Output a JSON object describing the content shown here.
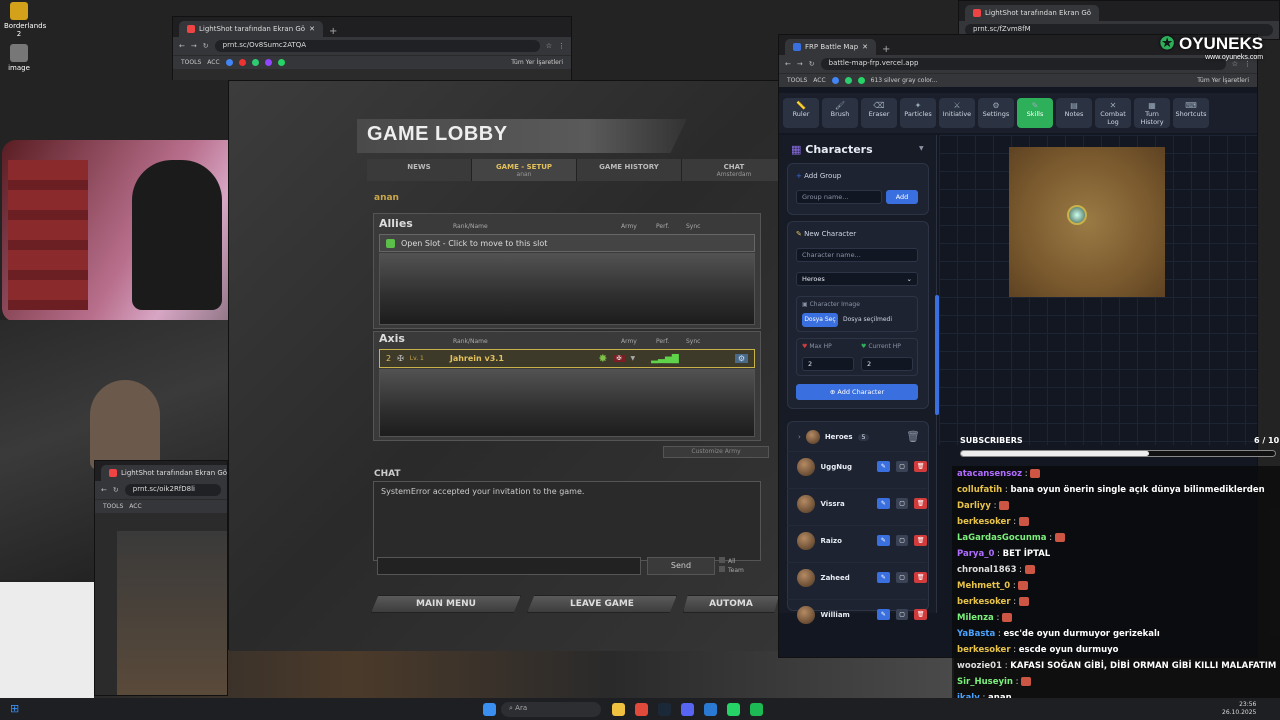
{
  "desktop": {
    "icons": [
      {
        "label": "Borderlands 2"
      },
      {
        "label": "image"
      }
    ]
  },
  "browser_left": {
    "tab_title": "LightShot tarafından Ekran Gö",
    "url": "prnt.sc/Ov8Sumc2ATQA",
    "bookmark_tools": "TOOLS",
    "bookmark_acc": "ACC",
    "bookmark_all": "Tüm Yer İşaretleri"
  },
  "browser_small": {
    "tab_title": "LightShot tarafından Ekran Gö",
    "url": "prnt.sc/oik2RfD8li",
    "bookmark_tools": "TOOLS",
    "bookmark_acc": "ACC"
  },
  "browser_right_back": {
    "tab_title": "LightShot tarafından Ekran Gö",
    "url": "prnt.sc/fZvm8fM"
  },
  "game": {
    "title": "GAME LOBBY",
    "tabs": [
      {
        "label": "NEWS",
        "sub": ""
      },
      {
        "label": "GAME - SETUP",
        "sub": "anan"
      },
      {
        "label": "GAME HISTORY",
        "sub": ""
      },
      {
        "label": "CHAT",
        "sub": "Amsterdam"
      }
    ],
    "lobby_name": "anan",
    "allies_label": "Allies",
    "axis_label": "Axis",
    "col_rank": "Rank/Name",
    "col_army": "Army",
    "col_perf": "Perf.",
    "col_sync": "Sync",
    "open_slot_text": "Open Slot - Click to move to this slot",
    "axis_slot": {
      "number": "2",
      "level": "Lv. 1",
      "name": "Jahrein v3.1"
    },
    "customize_army": "Customize Army",
    "chat_label": "CHAT",
    "chat_message": "SystemError accepted your invitation to the game.",
    "send_label": "Send",
    "all_label": "All",
    "team_label": "Team",
    "btn_main_menu": "MAIN MENU",
    "btn_leave_game": "LEAVE GAME",
    "btn_automatch": "AUTOMA"
  },
  "battlemap": {
    "tab_title": "FRP Battle Map",
    "url": "battle-map-frp.vercel.app",
    "bookmark_tools": "TOOLS",
    "bookmark_acc": "ACC",
    "bookmark_extra": "613 silver gray color...",
    "bookmark_all": "Tüm Yer İşaretleri",
    "tools": [
      {
        "label": "Ruler",
        "icon": "ruler-icon",
        "glyph": "📏"
      },
      {
        "label": "Brush",
        "icon": "brush-icon",
        "glyph": "🖌"
      },
      {
        "label": "Eraser",
        "icon": "eraser-icon",
        "glyph": "⌫"
      },
      {
        "label": "Particles",
        "icon": "particles-icon",
        "glyph": "✦"
      },
      {
        "label": "Initiative",
        "icon": "initiative-icon",
        "glyph": "⚔"
      },
      {
        "label": "Settings",
        "icon": "gear-icon",
        "glyph": "⚙"
      },
      {
        "label": "Skills",
        "icon": "skills-icon",
        "glyph": "✎"
      },
      {
        "label": "Notes",
        "icon": "notes-icon",
        "glyph": "▤"
      },
      {
        "label": "Combat Log",
        "icon": "combat-log-icon",
        "glyph": "✕"
      },
      {
        "label": "Turn History",
        "icon": "history-icon",
        "glyph": "▦"
      },
      {
        "label": "Shortcuts",
        "icon": "keyboard-icon",
        "glyph": "⌨"
      }
    ],
    "characters_title": "Characters",
    "add_group_label": "Add Group",
    "group_placeholder": "Group name...",
    "add_label": "Add",
    "new_character_label": "New Character",
    "character_placeholder": "Character name...",
    "group_select": "Heroes",
    "character_image_label": "Character Image",
    "choose_file": "Dosya Seç",
    "no_file": "Dosya seçilmedi",
    "max_hp_label": "Max HP",
    "max_hp_value": "2",
    "current_hp_label": "Current HP",
    "current_hp_value": "2",
    "add_character_label": "Add Character",
    "heroes_group": {
      "name": "Heroes",
      "count": "5"
    },
    "heroes": [
      {
        "name": "UggNug"
      },
      {
        "name": "Vissra"
      },
      {
        "name": "Raizo"
      },
      {
        "name": "Zaheed"
      },
      {
        "name": "William"
      }
    ]
  },
  "overlay": {
    "brand": "OYUNEKS",
    "brand_url": "www.oyuneks.com",
    "subscribers_label": "SUBSCRIBERS",
    "subscribers_count": "6 / 10",
    "subscribers_progress": 0.6
  },
  "chat": [
    {
      "user": "atacansensoz",
      "msg": "",
      "color": "#b06cff"
    },
    {
      "user": "collufatih",
      "msg": "bana oyun önerin single açık dünya bilinmediklerden",
      "color": "#e8c34a"
    },
    {
      "user": "Darliyy",
      "msg": "",
      "color": "#e8c34a"
    },
    {
      "user": "berkesoker",
      "msg": "",
      "color": "#e8c34a"
    },
    {
      "user": "LaGardasGocunma",
      "msg": "",
      "color": "#7cf07c"
    },
    {
      "user": "Parya_0",
      "msg": "BET İPTAL",
      "color": "#b06cff"
    },
    {
      "user": "chronal1863",
      "msg": "",
      "color": "#dddddd"
    },
    {
      "user": "Mehmett_0",
      "msg": "",
      "color": "#e8c34a"
    },
    {
      "user": "berkesoker",
      "msg": "",
      "color": "#e8c34a"
    },
    {
      "user": "Milenza",
      "msg": "",
      "color": "#7cf07c"
    },
    {
      "user": "YaBasta",
      "msg": "esc'de oyun durmuyor gerizekalı",
      "color": "#4aa3ff"
    },
    {
      "user": "berkesoker",
      "msg": "escde oyun durmuyo",
      "color": "#e8c34a"
    },
    {
      "user": "woozie01",
      "msg": "KAFASI SOĞAN GİBİ, DİBİ ORMAN GİBİ KILLI MALAFATIM",
      "color": "#dddddd"
    },
    {
      "user": "Sir_Huseyin",
      "msg": "",
      "color": "#7cf07c"
    },
    {
      "user": "jkaly",
      "msg": "anan",
      "color": "#4aa3ff"
    }
  ],
  "taskbar": {
    "search_placeholder": "Ara",
    "time": "23:56",
    "date": "26.10.2025"
  },
  "colors": {
    "accent_green": "#2eaf5a",
    "accent_blue": "#3a6fe0",
    "game_gold": "#e2c15c",
    "delete_red": "#d23b3b"
  }
}
